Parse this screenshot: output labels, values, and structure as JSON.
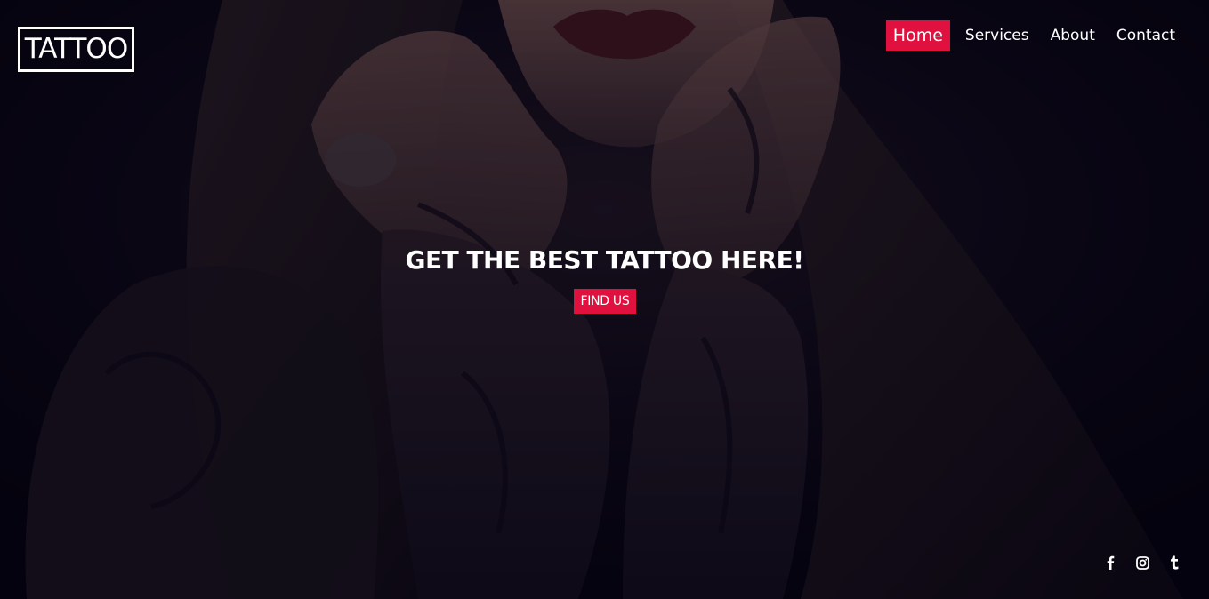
{
  "brand": {
    "logo_text": "TATTOO"
  },
  "nav": {
    "items": [
      {
        "label": "Home",
        "active": true
      },
      {
        "label": "Services",
        "active": false
      },
      {
        "label": "About",
        "active": false
      },
      {
        "label": "Contact",
        "active": false
      }
    ]
  },
  "hero": {
    "headline": "GET THE BEST TATTOO HERE!",
    "cta_label": "FIND US"
  },
  "social": {
    "icons": [
      "facebook-icon",
      "instagram-icon",
      "tumblr-icon"
    ]
  },
  "colors": {
    "accent": "#e0103f",
    "text": "#ffffff",
    "background": "#07050f"
  }
}
